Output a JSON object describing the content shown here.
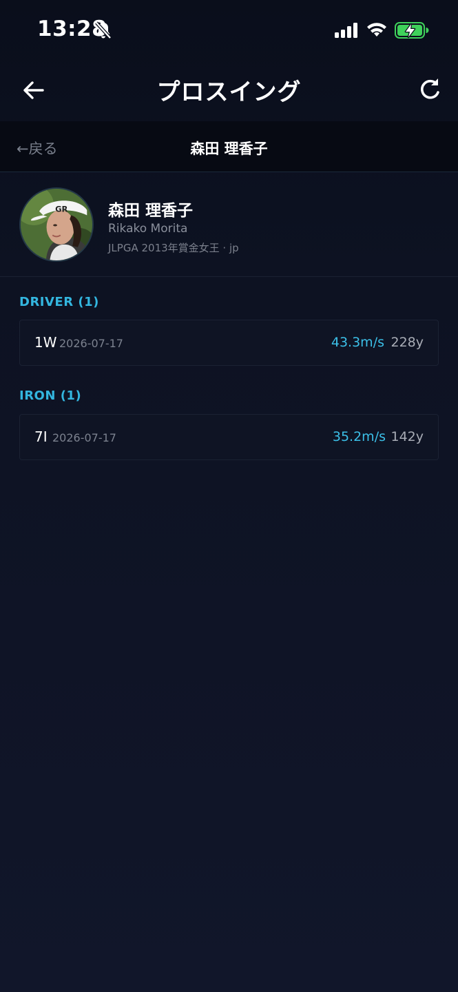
{
  "status_bar": {
    "time": "13:28",
    "icons": [
      "bell-muted-icon",
      "cellular-signal-icon",
      "wifi-icon",
      "battery-charging-icon"
    ]
  },
  "header": {
    "title": "プロスイング",
    "back_icon": "arrow-left-icon",
    "refresh_icon": "refresh-icon"
  },
  "sub_nav": {
    "back_label": "←戻る",
    "title": "森田 理香子"
  },
  "profile": {
    "name": "森田 理香子",
    "romaji": "Rikako Morita",
    "description": "JLPGA 2013年賞金女王 · jp"
  },
  "sections": [
    {
      "label": "DRIVER (1)",
      "swings": [
        {
          "club": "1W",
          "date": "2026-07-17",
          "speed": "43.3m/s",
          "distance": "228y"
        }
      ]
    },
    {
      "label": "IRON (1)",
      "swings": [
        {
          "club": "7I",
          "date": "2026-07-17",
          "speed": "35.2m/s",
          "distance": "142y"
        }
      ]
    }
  ],
  "colors": {
    "accent": "#33b6df",
    "background": "#0d1120",
    "card": "#0f1424",
    "battery": "#3fd15b"
  }
}
